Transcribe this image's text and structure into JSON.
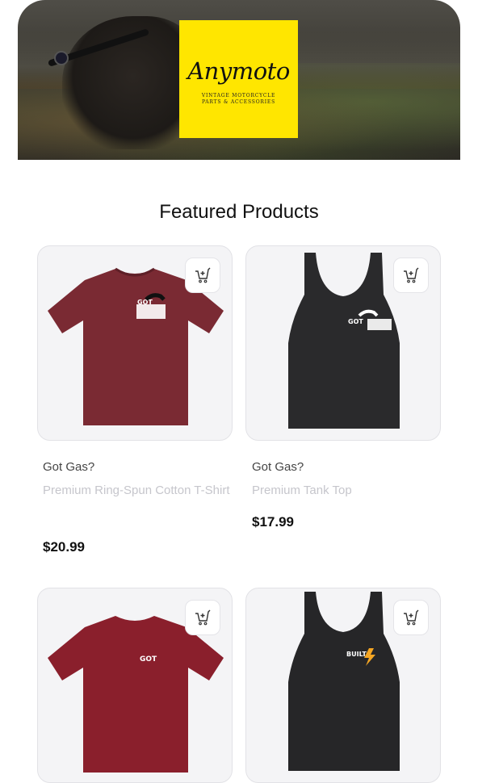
{
  "hero": {
    "brand": "Anymoto",
    "tagline_line1": "VINTAGE MOTORCYCLE",
    "tagline_line2": "PARTS & ACCESSORIES"
  },
  "section": {
    "title": "Featured Products"
  },
  "products": [
    {
      "name": "Got Gas?",
      "subtitle": "Premium Ring-Spun Cotton T-Shirt",
      "price": "$20.99",
      "color": "#7a2a33",
      "kind": "tshirt",
      "print": "GOT GAS?"
    },
    {
      "name": "Got Gas?",
      "subtitle": "Premium Tank Top",
      "price": "$17.99",
      "color": "#2a2a2c",
      "kind": "tank",
      "print": "GOT GAS?"
    },
    {
      "kind": "tshirt",
      "color": "#8a1f2c",
      "print": "GOT"
    },
    {
      "kind": "tank",
      "color": "#262628",
      "print": "BUILT"
    }
  ],
  "icons": {
    "cart": "add-to-cart-icon"
  }
}
